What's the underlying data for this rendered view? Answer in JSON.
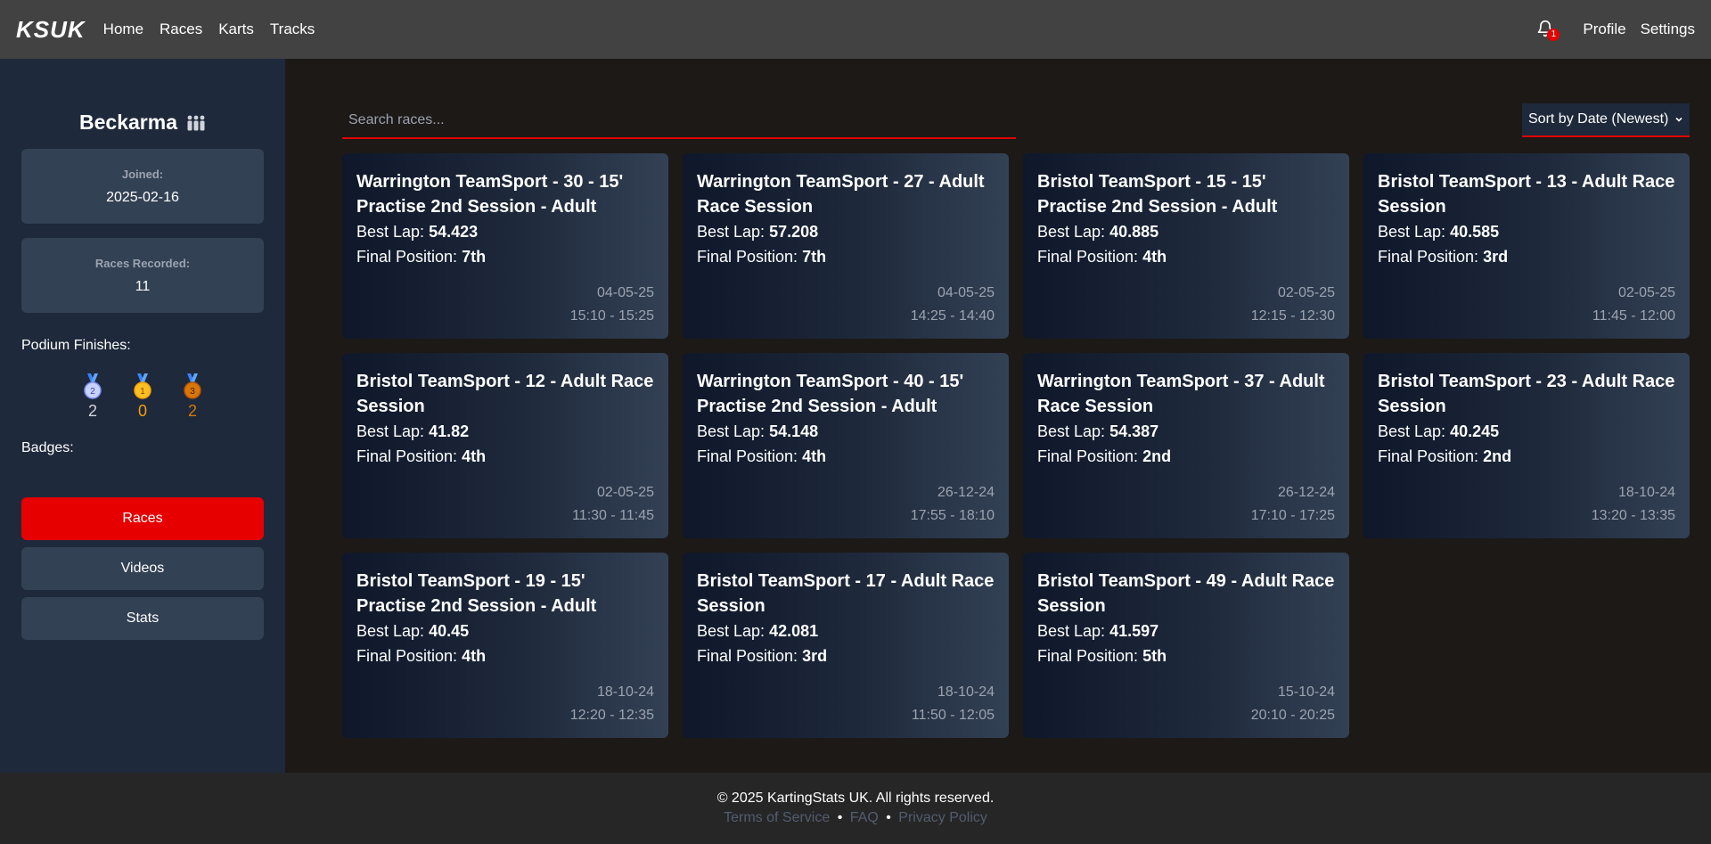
{
  "header": {
    "logo": "KSUK",
    "nav": [
      "Home",
      "Races",
      "Karts",
      "Tracks"
    ],
    "notification_count": "1",
    "profile": "Profile",
    "settings": "Settings"
  },
  "sidebar": {
    "username": "Beckarma",
    "joined_label": "Joined:",
    "joined_value": "2025-02-16",
    "races_label": "Races Recorded:",
    "races_value": "11",
    "podium_label": "Podium Finishes:",
    "podium": [
      {
        "place": "2",
        "count": "2",
        "color": "#a5b4fc"
      },
      {
        "place": "1",
        "count": "0",
        "color": "#f59e0b"
      },
      {
        "place": "3",
        "count": "2",
        "color": "#d97706"
      }
    ],
    "badges_label": "Badges:",
    "buttons": [
      "Races",
      "Videos",
      "Stats"
    ]
  },
  "main": {
    "search_placeholder": "Search races...",
    "sort_label": "Sort by Date (Newest)",
    "cards": [
      {
        "title": "Warrington TeamSport - 30 - 15' Practise 2nd Session - Adult",
        "best_lap_label": "Best Lap: ",
        "best_lap": "54.423",
        "position_label": "Final Position: ",
        "position": "7th",
        "date": "04-05-25",
        "time": "15:10 - 15:25"
      },
      {
        "title": "Warrington TeamSport - 27 - Adult Race Session",
        "best_lap_label": "Best Lap: ",
        "best_lap": "57.208",
        "position_label": "Final Position: ",
        "position": "7th",
        "date": "04-05-25",
        "time": "14:25 - 14:40"
      },
      {
        "title": "Bristol TeamSport - 15 - 15' Practise 2nd Session - Adult",
        "best_lap_label": "Best Lap: ",
        "best_lap": "40.885",
        "position_label": "Final Position: ",
        "position": "4th",
        "date": "02-05-25",
        "time": "12:15 - 12:30"
      },
      {
        "title": "Bristol TeamSport - 13 - Adult Race Session",
        "best_lap_label": "Best Lap: ",
        "best_lap": "40.585",
        "position_label": "Final Position: ",
        "position": "3rd",
        "date": "02-05-25",
        "time": "11:45 - 12:00"
      },
      {
        "title": "Bristol TeamSport - 12 - Adult Race Session",
        "best_lap_label": "Best Lap: ",
        "best_lap": "41.82",
        "position_label": "Final Position: ",
        "position": "4th",
        "date": "02-05-25",
        "time": "11:30 - 11:45"
      },
      {
        "title": "Warrington TeamSport - 40 - 15' Practise 2nd Session - Adult",
        "best_lap_label": "Best Lap: ",
        "best_lap": "54.148",
        "position_label": "Final Position: ",
        "position": "4th",
        "date": "26-12-24",
        "time": "17:55 - 18:10"
      },
      {
        "title": "Warrington TeamSport - 37 - Adult Race Session",
        "best_lap_label": "Best Lap: ",
        "best_lap": "54.387",
        "position_label": "Final Position: ",
        "position": "2nd",
        "date": "26-12-24",
        "time": "17:10 - 17:25"
      },
      {
        "title": "Bristol TeamSport - 23 - Adult Race Session",
        "best_lap_label": "Best Lap: ",
        "best_lap": "40.245",
        "position_label": "Final Position: ",
        "position": "2nd",
        "date": "18-10-24",
        "time": "13:20 - 13:35"
      },
      {
        "title": "Bristol TeamSport - 19 - 15' Practise 2nd Session - Adult",
        "best_lap_label": "Best Lap: ",
        "best_lap": "40.45",
        "position_label": "Final Position: ",
        "position": "4th",
        "date": "18-10-24",
        "time": "12:20 - 12:35"
      },
      {
        "title": "Bristol TeamSport - 17 - Adult Race Session",
        "best_lap_label": "Best Lap: ",
        "best_lap": "42.081",
        "position_label": "Final Position: ",
        "position": "3rd",
        "date": "18-10-24",
        "time": "11:50 - 12:05"
      },
      {
        "title": "Bristol TeamSport - 49 - Adult Race Session",
        "best_lap_label": "Best Lap: ",
        "best_lap": "41.597",
        "position_label": "Final Position: ",
        "position": "5th",
        "date": "15-10-24",
        "time": "20:10 - 20:25"
      }
    ]
  },
  "footer": {
    "copyright": "© 2025 KartingStats UK. All rights reserved.",
    "links": [
      "Terms of Service",
      "FAQ",
      "Privacy Policy"
    ],
    "separator": "•"
  },
  "colors": {
    "accent": "#e60000",
    "sidebar_bg": "#1e293b",
    "header_bg": "#424242"
  },
  "icons": {
    "notification": "bell-icon",
    "user_group": "group-icon",
    "sort": "chevron-down-icon",
    "medal": "medal-icon"
  }
}
